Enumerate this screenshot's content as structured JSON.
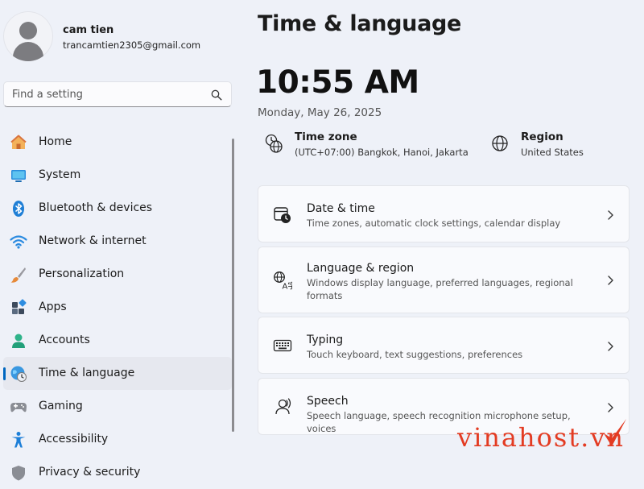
{
  "user": {
    "name": "cam tien",
    "email": "trancamtien2305@gmail.com"
  },
  "search": {
    "placeholder": "Find a setting"
  },
  "nav": [
    {
      "label": "Home",
      "icon": "home-icon"
    },
    {
      "label": "System",
      "icon": "system-icon"
    },
    {
      "label": "Bluetooth & devices",
      "icon": "bluetooth-icon"
    },
    {
      "label": "Network & internet",
      "icon": "wifi-icon"
    },
    {
      "label": "Personalization",
      "icon": "brush-icon"
    },
    {
      "label": "Apps",
      "icon": "apps-icon"
    },
    {
      "label": "Accounts",
      "icon": "accounts-icon"
    },
    {
      "label": "Time & language",
      "icon": "globe-clock-icon",
      "active": true
    },
    {
      "label": "Gaming",
      "icon": "gamepad-icon"
    },
    {
      "label": "Accessibility",
      "icon": "accessibility-icon"
    },
    {
      "label": "Privacy & security",
      "icon": "shield-icon"
    }
  ],
  "main": {
    "title": "Time & language",
    "time": "10:55 AM",
    "date": "Monday, May 26, 2025",
    "timezone": {
      "title": "Time zone",
      "value": "(UTC+07:00) Bangkok, Hanoi, Jakarta"
    },
    "region": {
      "title": "Region",
      "value": "United States"
    },
    "cards": [
      {
        "title": "Date & time",
        "desc": "Time zones, automatic clock settings, calendar display",
        "icon": "calendar-clock-icon"
      },
      {
        "title": "Language & region",
        "desc": "Windows display language, preferred languages, regional formats",
        "icon": "language-icon"
      },
      {
        "title": "Typing",
        "desc": "Touch keyboard, text suggestions, preferences",
        "icon": "keyboard-icon"
      },
      {
        "title": "Speech",
        "desc": "Speech language, speech recognition microphone setup, voices",
        "icon": "speech-icon"
      }
    ]
  },
  "watermark": {
    "text": "vinahost.vn"
  },
  "colors": {
    "accent": "#0067c0",
    "background": "#eef1f8",
    "watermark": "#e33b22"
  }
}
